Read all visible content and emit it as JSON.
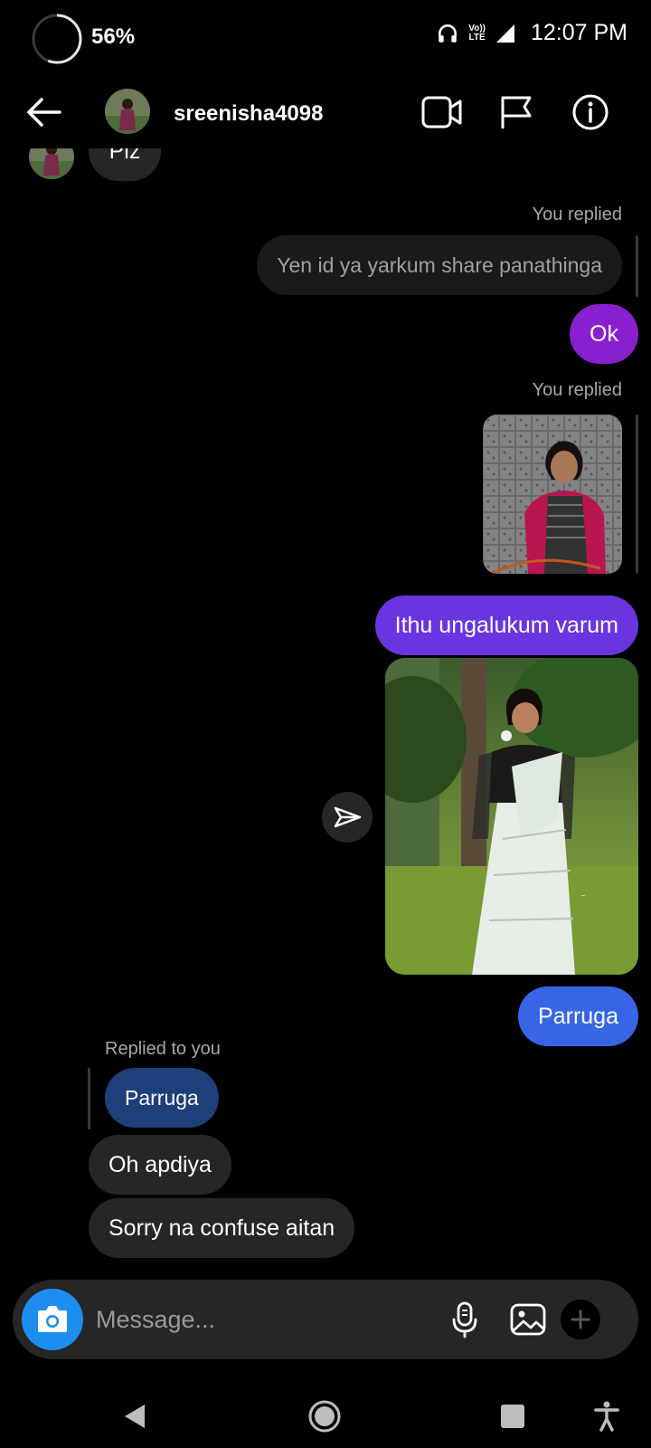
{
  "status": {
    "battery": "56%",
    "time": "12:07 PM",
    "network_top": "Vo))",
    "network_bottom": "LTE",
    "signal_label": "LTE"
  },
  "header": {
    "username": "sreenisha4098"
  },
  "chat": {
    "partial_message": "Plz",
    "replied_label_1": "You replied",
    "quoted_message_1": "Yen id ya yarkum share panathinga",
    "msg_ok": "Ok",
    "replied_label_2": "You replied",
    "msg_ithu": "Ithu ungalukum varum",
    "msg_parruga": "Parruga",
    "replied_to_you_label": "Replied to you",
    "quoted_parruga": "Parruga",
    "msg_oh": "Oh apdiya",
    "msg_sorry": "Sorry na confuse aitan"
  },
  "composer": {
    "placeholder": "Message..."
  },
  "colors": {
    "purple_1": "#8a1fd0",
    "purple_2": "#6a35e0",
    "blue": "#3865e6",
    "dark_blue": "#1f3f7a",
    "gray_bubble": "#262626",
    "camera_blue": "#1d8ef0"
  }
}
